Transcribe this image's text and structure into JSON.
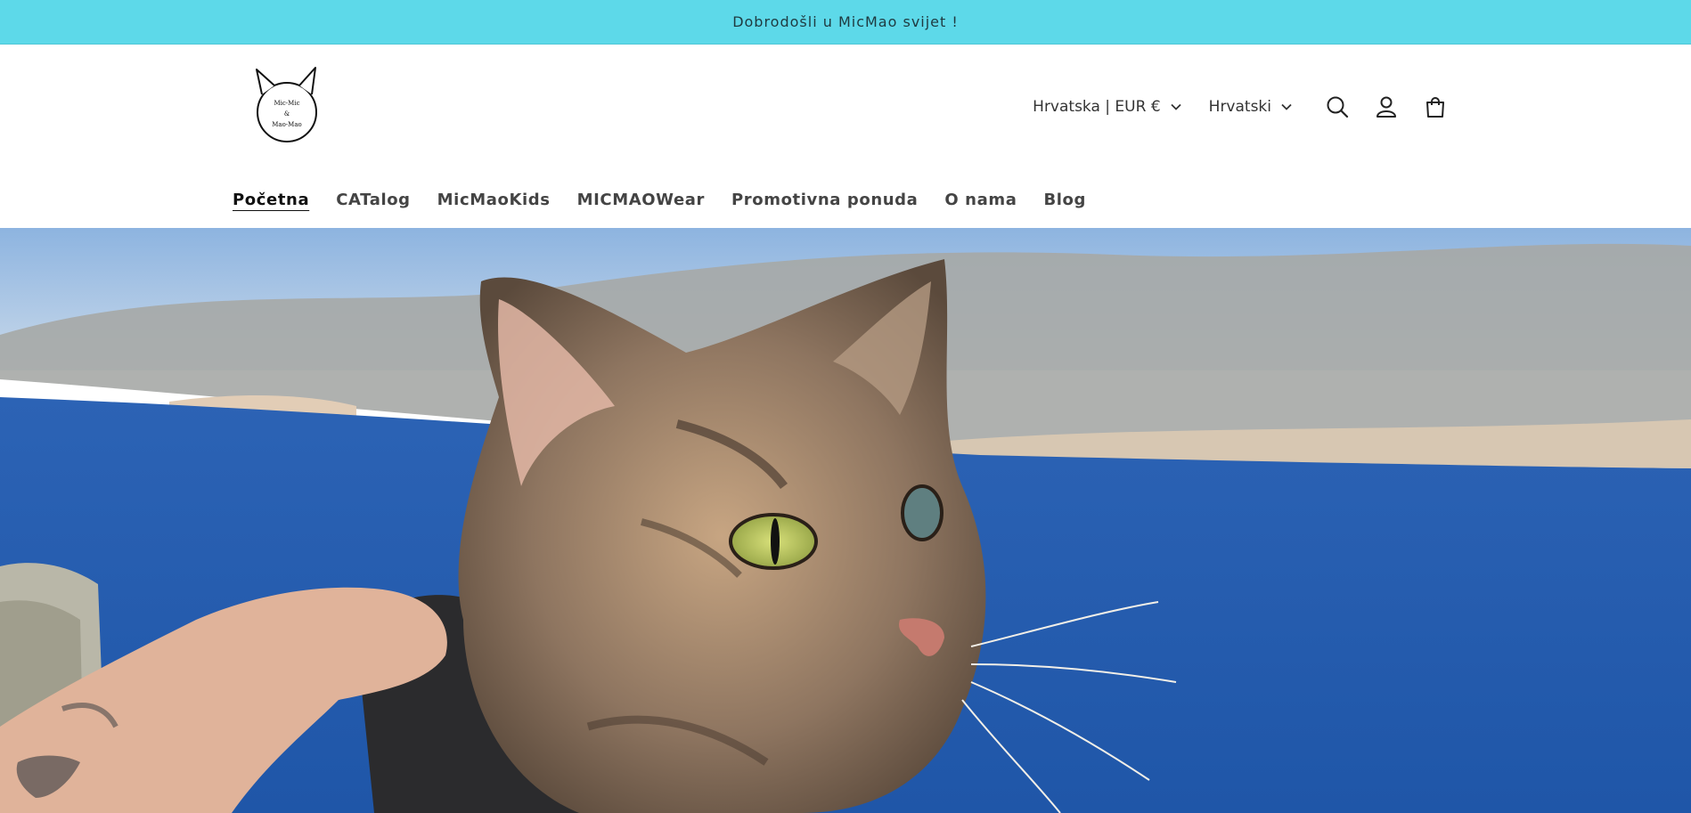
{
  "announcement": {
    "text": "Dobrodošli u MicMao svijet !"
  },
  "logo": {
    "line1": "Mic-Mic",
    "line2": "&",
    "line3": "Mao-Mao"
  },
  "header": {
    "country_selector": "Hrvatska | EUR €",
    "language_selector": "Hrvatski",
    "icons": [
      "search-icon",
      "account-icon",
      "cart-icon"
    ]
  },
  "nav": {
    "items": [
      {
        "label": "Početna",
        "active": true
      },
      {
        "label": "CATalog"
      },
      {
        "label": "MicMaoKids"
      },
      {
        "label": "MICMAOWear"
      },
      {
        "label": "Promotivna ponuda"
      },
      {
        "label": "O nama"
      },
      {
        "label": "Blog"
      }
    ]
  },
  "colors": {
    "announcement_bg": "#5dd9e9",
    "sea": "#2f66b8",
    "sky": "#9fc3e6"
  }
}
